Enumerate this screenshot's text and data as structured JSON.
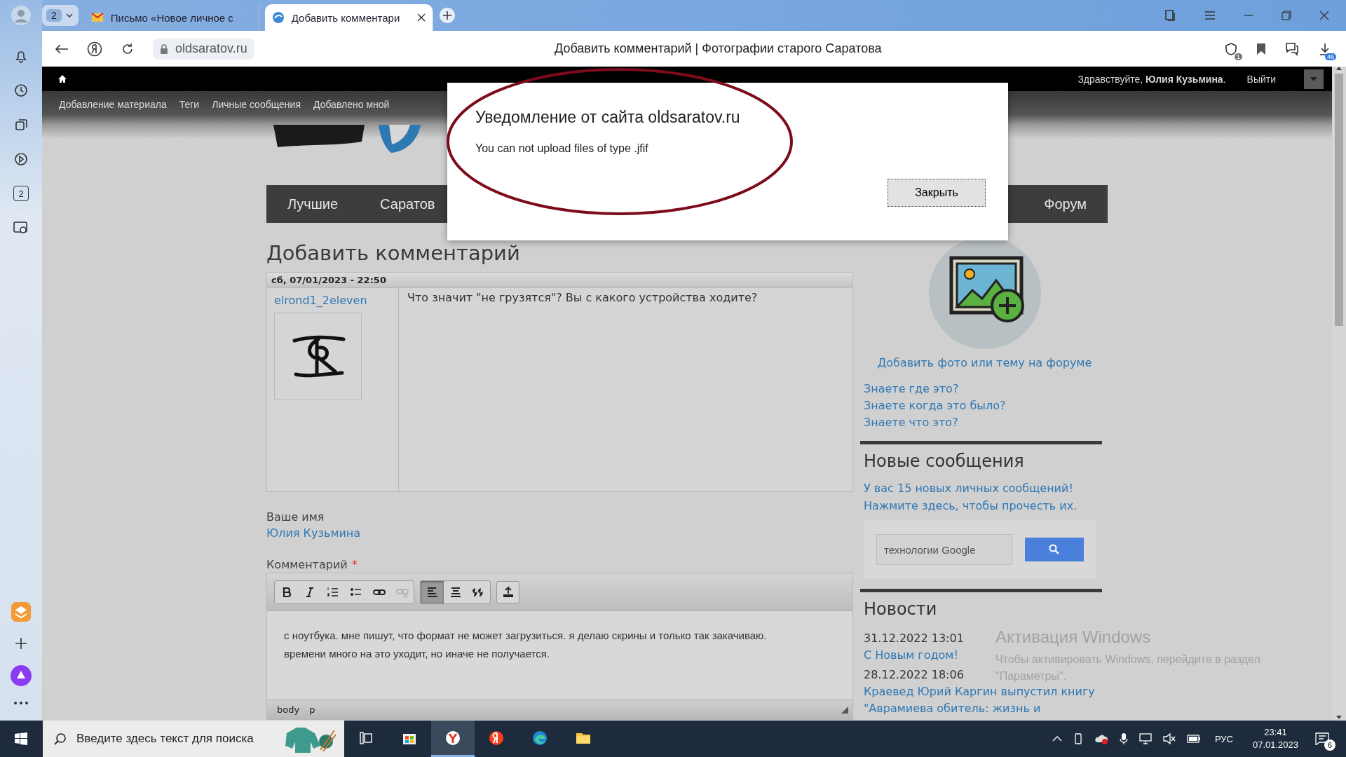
{
  "browser": {
    "tab_group_count": "2",
    "tabs": [
      {
        "title": "Письмо «Новое личное с",
        "selected": false
      },
      {
        "title": "Добавить комментари",
        "selected": true
      }
    ],
    "address": "oldsaratov.ru",
    "page_title": "Добавить комментарий | Фотографии старого Саратова",
    "shield_badge": "1",
    "downloads_badge": "46",
    "sidebar_tab_count": "2"
  },
  "site": {
    "greeting": "Здравствуйте, **Юлия Кузьмина**.",
    "logout": "Выйти",
    "menu": [
      "Добавление материала",
      "Теги",
      "Личные сообщения",
      "Добавлено мной"
    ],
    "nav": [
      "Лучшие",
      "Саратов",
      "Форум"
    ],
    "heading": "Добавить комментарий"
  },
  "comment": {
    "date": "сб, 07/01/2023 - 22:50",
    "author": "elrond1_2eleven",
    "text": "Что значит \"не грузятся\"? Вы с какого устройства ходите?"
  },
  "form": {
    "name_label": "Ваше имя",
    "name_value": "Юлия Кузьмина",
    "comment_label": "Комментарий",
    "required_mark": "*",
    "toolbar_groups": [
      {
        "buttons": [
          {
            "kind": "bold",
            "selected": false,
            "disabled": false
          },
          {
            "kind": "italic",
            "selected": false,
            "disabled": false
          },
          {
            "kind": "numbered-list",
            "selected": false,
            "disabled": false
          },
          {
            "kind": "bullet-list",
            "selected": false,
            "disabled": false
          },
          {
            "kind": "link",
            "selected": false,
            "disabled": false
          },
          {
            "kind": "unlink",
            "selected": false,
            "disabled": true
          }
        ]
      },
      {
        "buttons": [
          {
            "kind": "align-left",
            "selected": true,
            "disabled": false
          },
          {
            "kind": "align-center",
            "selected": false,
            "disabled": false
          },
          {
            "kind": "quote",
            "selected": false,
            "disabled": false
          }
        ]
      },
      {
        "buttons": [
          {
            "kind": "upload",
            "selected": false,
            "disabled": false
          }
        ]
      }
    ],
    "editor_lines": [
      "с ноутбука. мне пишут, что формат не может загрузиться. я делаю скрины и только так закачиваю.",
      "времени много на это уходит, но иначе не получается."
    ],
    "element_path": [
      "body",
      "p"
    ]
  },
  "sidebar": {
    "add_link": "Добавить фото или тему на форуме",
    "quiz_links": [
      "Знаете где это?",
      "Знаете когда это было?",
      "Знаете что это?"
    ],
    "messages_heading": "Новые сообщения",
    "messages_lines": [
      "У вас 15 новых личных сообщений!",
      "Нажмите здесь, чтобы прочесть их."
    ],
    "search_placeholder": "технологии Google",
    "news_heading": "Новости",
    "news": [
      {
        "date": "31.12.2022 13:01",
        "title": "С Новым годом!"
      },
      {
        "date": "28.12.2022 18:06",
        "title": "Краевед Юрий Каргин выпустил книгу \"Аврамиева обитель: жизнь и"
      }
    ]
  },
  "dialog": {
    "title": "Уведомление от сайта oldsaratov.ru",
    "message": "You can not upload files of type .jfif",
    "button": "Закрыть"
  },
  "activation": {
    "title": "Активация Windows",
    "text": "Чтобы активировать Windows, перейдите в раздел \"Параметры\"."
  },
  "taskbar": {
    "search_placeholder": "Введите здесь текст для поиска",
    "apps": [
      {
        "kind": "task-view",
        "selected": false
      },
      {
        "kind": "store",
        "selected": false
      },
      {
        "kind": "y-browser",
        "selected": true
      },
      {
        "kind": "yandex",
        "selected": false
      },
      {
        "kind": "edge",
        "selected": false
      },
      {
        "kind": "folder",
        "selected": false
      }
    ],
    "language": "РУС",
    "time": "23:41",
    "date": "07.01.2023",
    "notifications": "6"
  }
}
